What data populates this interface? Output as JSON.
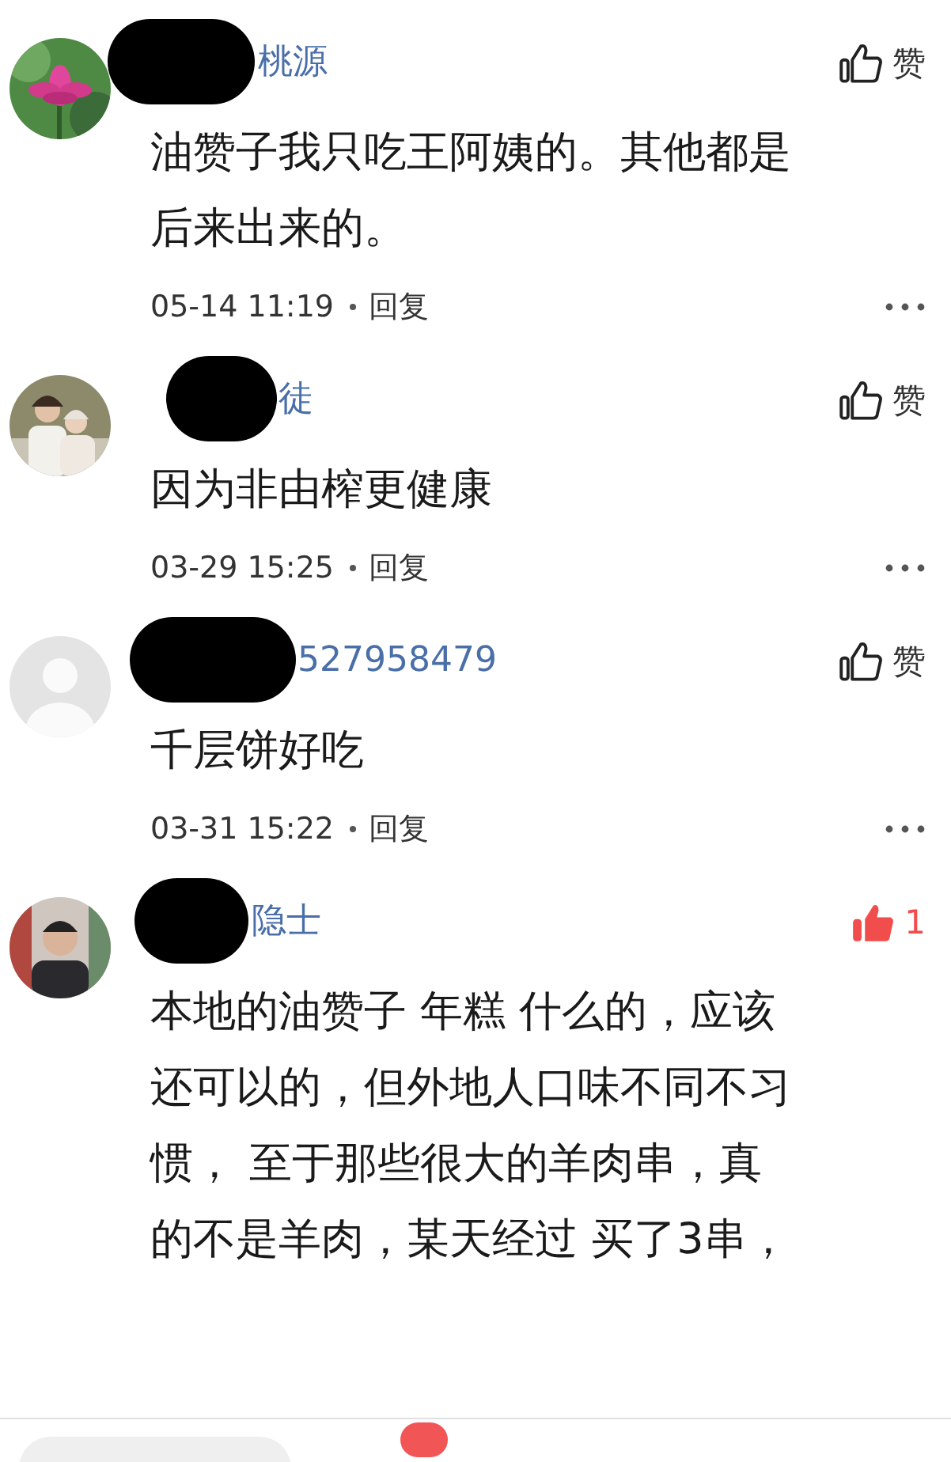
{
  "comments": [
    {
      "avatar": {
        "kind": "picture"
      },
      "name": "桃源",
      "lines": [
        "油赞子我只吃王阿姨的。其他都是",
        "后来出来的。"
      ],
      "date": "05-14 11:19",
      "reply": "回复",
      "like": {
        "liked": false,
        "label": "赞"
      }
    },
    {
      "avatar": {
        "kind": "picture"
      },
      "name": "徒",
      "lines": [
        "因为非由榨更健康"
      ],
      "date": "03-29 15:25",
      "reply": "回复",
      "like": {
        "liked": false,
        "label": "赞"
      }
    },
    {
      "avatar": {
        "kind": "placeholder"
      },
      "name": "527958479",
      "lines": [
        "千层饼好吃"
      ],
      "date": "03-31 15:22",
      "reply": "回复",
      "like": {
        "liked": false,
        "label": "赞"
      }
    },
    {
      "avatar": {
        "kind": "picture"
      },
      "name": "隐士",
      "lines": [
        "本地的油赞子 年糕 什么的，应该",
        "还可以的，但外地人口味不同不习",
        "惯， 至于那些很大的羊肉串，真",
        "的不是羊肉，某天经过 买了3串，"
      ],
      "like": {
        "liked": true,
        "label": "1"
      }
    }
  ]
}
